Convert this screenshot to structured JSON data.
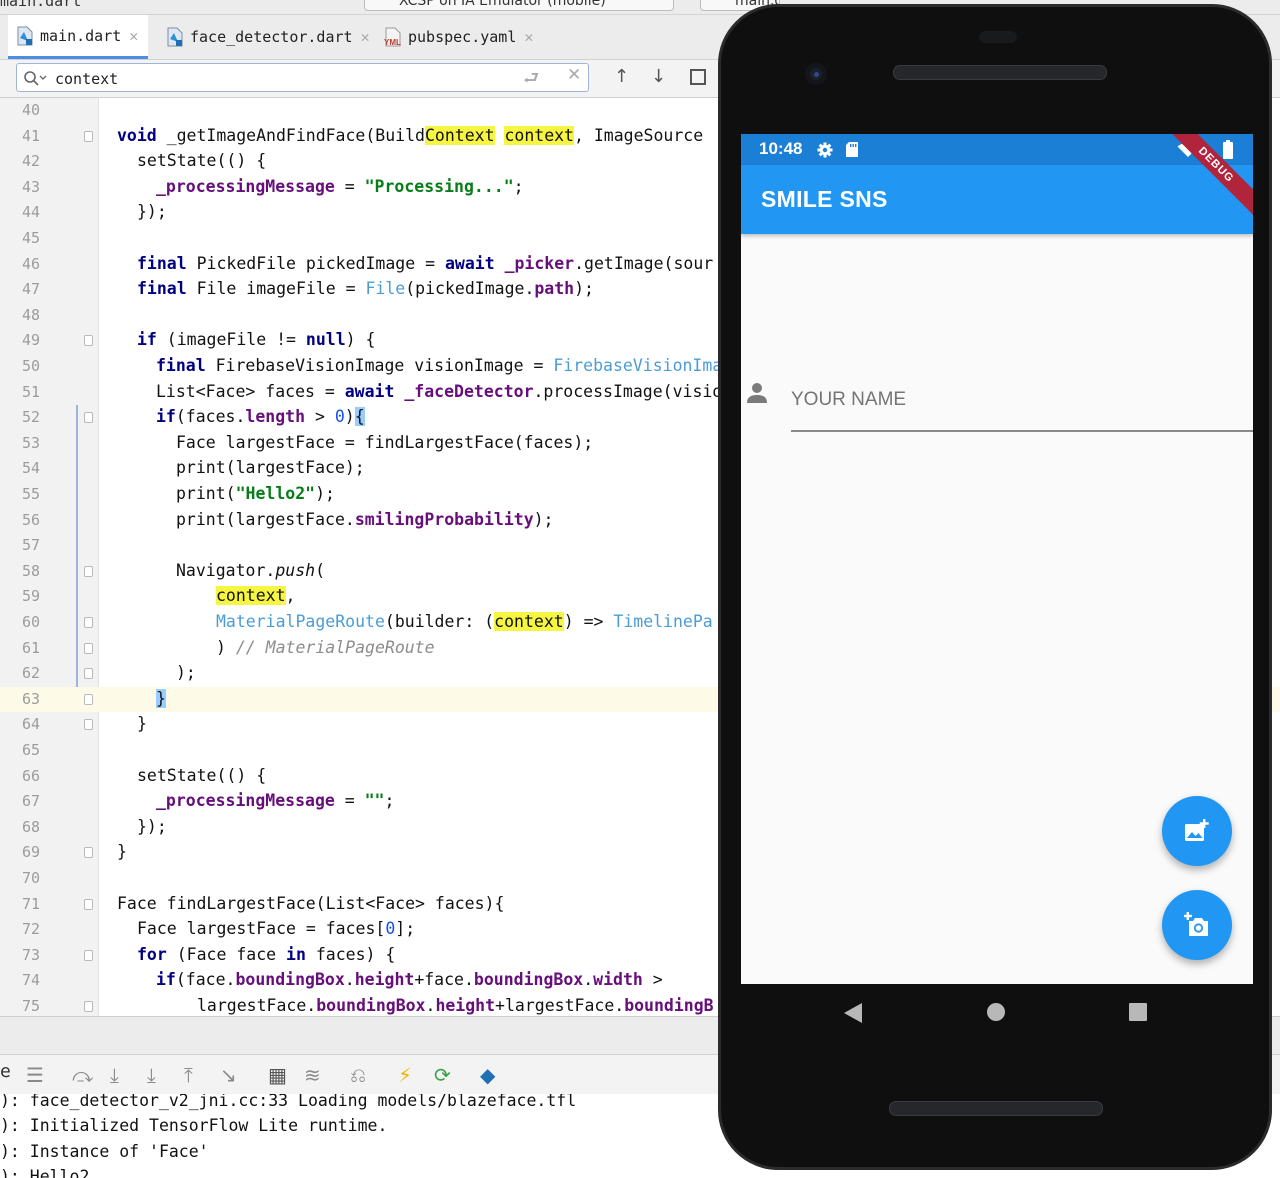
{
  "top": {
    "prev_tab_fragment": "main.dart",
    "run_config": "XCSP on IA Emulator (mobile)",
    "run_config2": "main.dart"
  },
  "tabs": [
    {
      "label": "main.dart",
      "active": true
    },
    {
      "label": "face_detector.dart",
      "active": false
    },
    {
      "label": "pubspec.yaml",
      "active": false
    }
  ],
  "search": {
    "query": "context"
  },
  "editor": {
    "current_line": 63,
    "line_numbers": [
      "40",
      "41",
      "42",
      "43",
      "44",
      "45",
      "46",
      "47",
      "48",
      "49",
      "50",
      "51",
      "52",
      "53",
      "54",
      "55",
      "56",
      "57",
      "58",
      "59",
      "60",
      "61",
      "62",
      "63",
      "64",
      "65",
      "66",
      "67",
      "68",
      "69",
      "70",
      "71",
      "72",
      "73",
      "74",
      "75"
    ]
  },
  "code": {
    "l41": {
      "a": "void",
      "b": " _getImageAndFindFace(Build",
      "c": "Context",
      "d": " ",
      "e": "context",
      "f": ", ImageSource "
    },
    "l42": "setState(() {",
    "l43": {
      "a": "_processingMessage",
      "b": " = ",
      "c": "\"Processing...\"",
      "d": ";"
    },
    "l44": "});",
    "l46": {
      "a": "final",
      "b": " PickedFile pickedImage = ",
      "c": "await",
      "d": " ",
      "e": "_picker",
      "f": ".getImage(sour"
    },
    "l47": {
      "a": "final",
      "b": " File imageFile = ",
      "c": "File",
      "d": "(pickedImage.",
      "e": "path",
      "f": ");"
    },
    "l49": {
      "a": "if",
      "b": " (imageFile != ",
      "c": "null",
      "d": ") {"
    },
    "l50": {
      "a": "final",
      "b": " FirebaseVisionImage visionImage = ",
      "c": "FirebaseVisionIma"
    },
    "l51": {
      "a": "List<Face> faces = ",
      "b": "await",
      "c": " ",
      "d": "_faceDetector",
      "e": ".processImage(visio"
    },
    "l52": {
      "a": "if",
      "b": "(faces.",
      "c": "length",
      "d": " > ",
      "e": "0",
      "f": ")",
      "g": "{"
    },
    "l53": "Face largestFace = findLargestFace(faces);",
    "l54": "print(largestFace);",
    "l55": {
      "a": "print(",
      "b": "\"Hello2\"",
      "c": ");"
    },
    "l56": {
      "a": "print(largestFace.",
      "b": "smilingProbability",
      "c": ");"
    },
    "l58": {
      "a": "Navigator.",
      "b": "push",
      "c": "("
    },
    "l59": {
      "a": "context",
      "b": ","
    },
    "l60": {
      "a": "MaterialPageRoute",
      "b": "(builder: (",
      "c": "context",
      "d": ") => ",
      "e": "TimelinePa"
    },
    "l61": {
      "a": ") ",
      "b": "// MaterialPageRoute"
    },
    "l62": ");",
    "l63": "}",
    "l64": "}",
    "l66": "setState(() {",
    "l67": {
      "a": "_processingMessage",
      "b": " = ",
      "c": "\"\"",
      "d": ";"
    },
    "l68": "});",
    "l69": "}",
    "l71": "Face findLargestFace(List<Face> faces){",
    "l72": {
      "a": "Face largestFace = faces[",
      "b": "0",
      "c": "];"
    },
    "l73": {
      "a": "for",
      "b": " (Face face ",
      "c": "in",
      "d": " faces) {"
    },
    "l74": {
      "a": "if",
      "b": "(face.",
      "c": "boundingBox",
      "d": ".",
      "e": "height",
      "f": "+face.",
      "g": "boundingBox",
      "h": ".",
      "i": "width",
      "j": " >"
    },
    "l75": {
      "a": "largestFace.",
      "b": "boundingBox",
      "c": ".",
      "d": "height",
      "e": "+largestFace.",
      "f": "boundingB"
    }
  },
  "console": {
    "lines": [
      "): face_detector_v2_jni.cc:33 Loading models/blazeface.tfl",
      "): Initialized TensorFlow Lite runtime.",
      "): Instance of 'Face'",
      "): Hello2"
    ],
    "side_label": "e"
  },
  "emulator": {
    "status_time": "10:48",
    "app_title": "SMILE SNS",
    "debug_banner": "DEBUG",
    "name_placeholder": "YOUR NAME",
    "accent": "#2196f3",
    "status_color": "#1c7fd6"
  }
}
